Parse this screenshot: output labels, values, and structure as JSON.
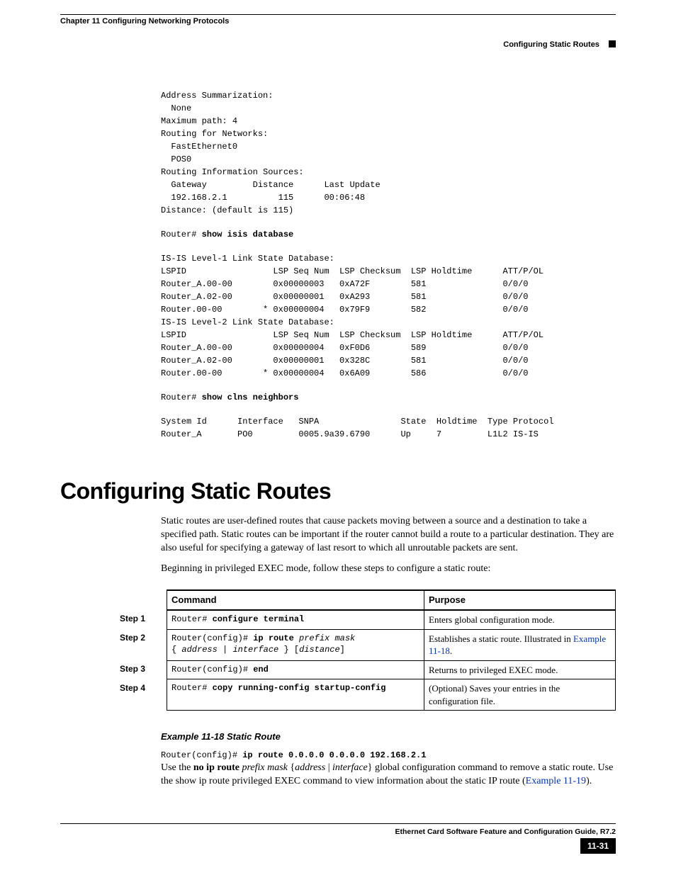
{
  "header": {
    "chapter": "Chapter 11 Configuring Networking Protocols",
    "section": "Configuring Static Routes"
  },
  "cli_block1": "Address Summarization:\n  None\nMaximum path: 4\nRouting for Networks:\n  FastEthernet0\n  POS0\nRouting Information Sources:\n  Gateway         Distance      Last Update\n  192.168.2.1          115      00:06:48\nDistance: (default is 115)",
  "cli_prompt1": "Router# ",
  "cli_cmd1": "show isis database",
  "cli_block2": "IS-IS Level-1 Link State Database:\nLSPID                 LSP Seq Num  LSP Checksum  LSP Holdtime      ATT/P/OL\nRouter_A.00-00        0x00000003   0xA72F        581               0/0/0\nRouter_A.02-00        0x00000001   0xA293        581               0/0/0\nRouter.00-00        * 0x00000004   0x79F9        582               0/0/0\nIS-IS Level-2 Link State Database:\nLSPID                 LSP Seq Num  LSP Checksum  LSP Holdtime      ATT/P/OL\nRouter_A.00-00        0x00000004   0xF0D6        589               0/0/0\nRouter_A.02-00        0x00000001   0x328C        581               0/0/0\nRouter.00-00        * 0x00000004   0x6A09        586               0/0/0",
  "cli_prompt2": "Router# ",
  "cli_cmd2": "show clns neighbors",
  "cli_block3": "System Id      Interface   SNPA                State  Holdtime  Type Protocol\nRouter_A       PO0         0005.9a39.6790      Up     7         L1L2 IS-IS",
  "section_title": "Configuring Static Routes",
  "para1": "Static routes are user-defined routes that cause packets moving between a source and a destination to take a specified path. Static routes can be important if the router cannot build a route to a particular destination. They are also useful for specifying a gateway of last resort to which all unroutable packets are sent.",
  "para2": "Beginning in privileged EXEC mode, follow these steps to configure a static route:",
  "table": {
    "head_command": "Command",
    "head_purpose": "Purpose",
    "rows": [
      {
        "step": "Step 1",
        "prompt": "Router# ",
        "bold": "configure terminal",
        "rest": "",
        "purpose_plain": "Enters global configuration mode.",
        "purpose_link": ""
      },
      {
        "step": "Step 2",
        "prompt": "Router(config)# ",
        "bold": "ip route",
        "rest": " prefix mask\n{ address | interface } [distance]",
        "purpose_plain": "Establishes a static route. Illustrated in ",
        "purpose_link": "Example 11-18",
        "purpose_after": "."
      },
      {
        "step": "Step 3",
        "prompt": "Router(config)# ",
        "bold": "end",
        "rest": "",
        "purpose_plain": "Returns to privileged EXEC mode.",
        "purpose_link": ""
      },
      {
        "step": "Step 4",
        "prompt": "Router# ",
        "bold": "copy running-config startup-config",
        "rest": "",
        "purpose_plain": "(Optional) Saves your entries in the configuration file.",
        "purpose_link": ""
      }
    ]
  },
  "example_title": "Example 11-18 Static Route",
  "example_cmd_prompt": "Router(config)# ",
  "example_cmd_bold": "ip route 0.0.0.0 0.0.0.0 192.168.2.1",
  "para3_pre": "Use the ",
  "para3_bold": "no ip route",
  "para3_italic": " prefix mask ",
  "para3_brace": "{address | interface}",
  "para3_post": " global configuration command to remove a static route. Use the show ip route privileged EXEC command to view information about the static IP route (",
  "para3_link": "Example 11-19",
  "para3_end": ").",
  "footer": {
    "guide": "Ethernet Card Software Feature and Configuration Guide, R7.2",
    "page": "11-31"
  }
}
